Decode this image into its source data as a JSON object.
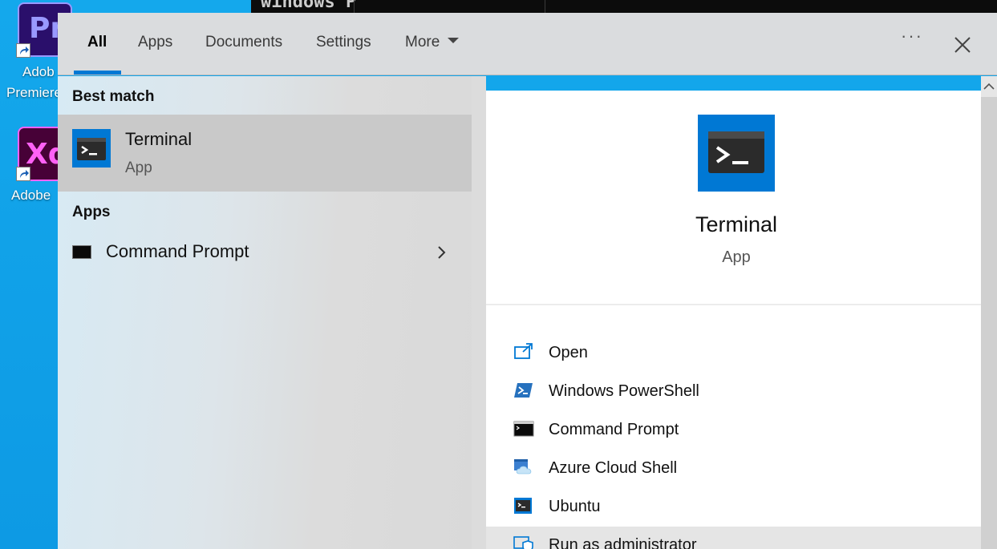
{
  "desktop": {
    "icons": [
      {
        "tile_text": "Pr",
        "label": "Adob",
        "label2": "Premiere",
        "color": "#2a0f6b",
        "text_color": "#9999ff"
      },
      {
        "tile_text": "Xd",
        "label": "Adobe",
        "color": "#470137",
        "text_color": "#ff61f6"
      }
    ],
    "background_terminal_text": "windows P"
  },
  "search": {
    "tabs": [
      {
        "label": "All",
        "active": true
      },
      {
        "label": "Apps"
      },
      {
        "label": "Documents"
      },
      {
        "label": "Settings"
      },
      {
        "label": "More"
      }
    ],
    "ellipsis": "···",
    "accent": "#0078d4"
  },
  "results": {
    "best_match_heading": "Best match",
    "best_match": {
      "name": "Terminal",
      "type": "App",
      "icon": "terminal-icon"
    },
    "apps_heading": "Apps",
    "apps": [
      {
        "name": "Command Prompt",
        "icon": "command-prompt-icon"
      }
    ]
  },
  "details": {
    "name": "Terminal",
    "type": "App",
    "actions": [
      {
        "label": "Open",
        "icon": "open-icon"
      },
      {
        "label": "Windows PowerShell",
        "icon": "powershell-icon"
      },
      {
        "label": "Command Prompt",
        "icon": "command-prompt-icon"
      },
      {
        "label": "Azure Cloud Shell",
        "icon": "azure-cloud-shell-icon"
      },
      {
        "label": "Ubuntu",
        "icon": "ubuntu-icon"
      },
      {
        "label": "Run as administrator",
        "icon": "shield-icon"
      }
    ]
  }
}
